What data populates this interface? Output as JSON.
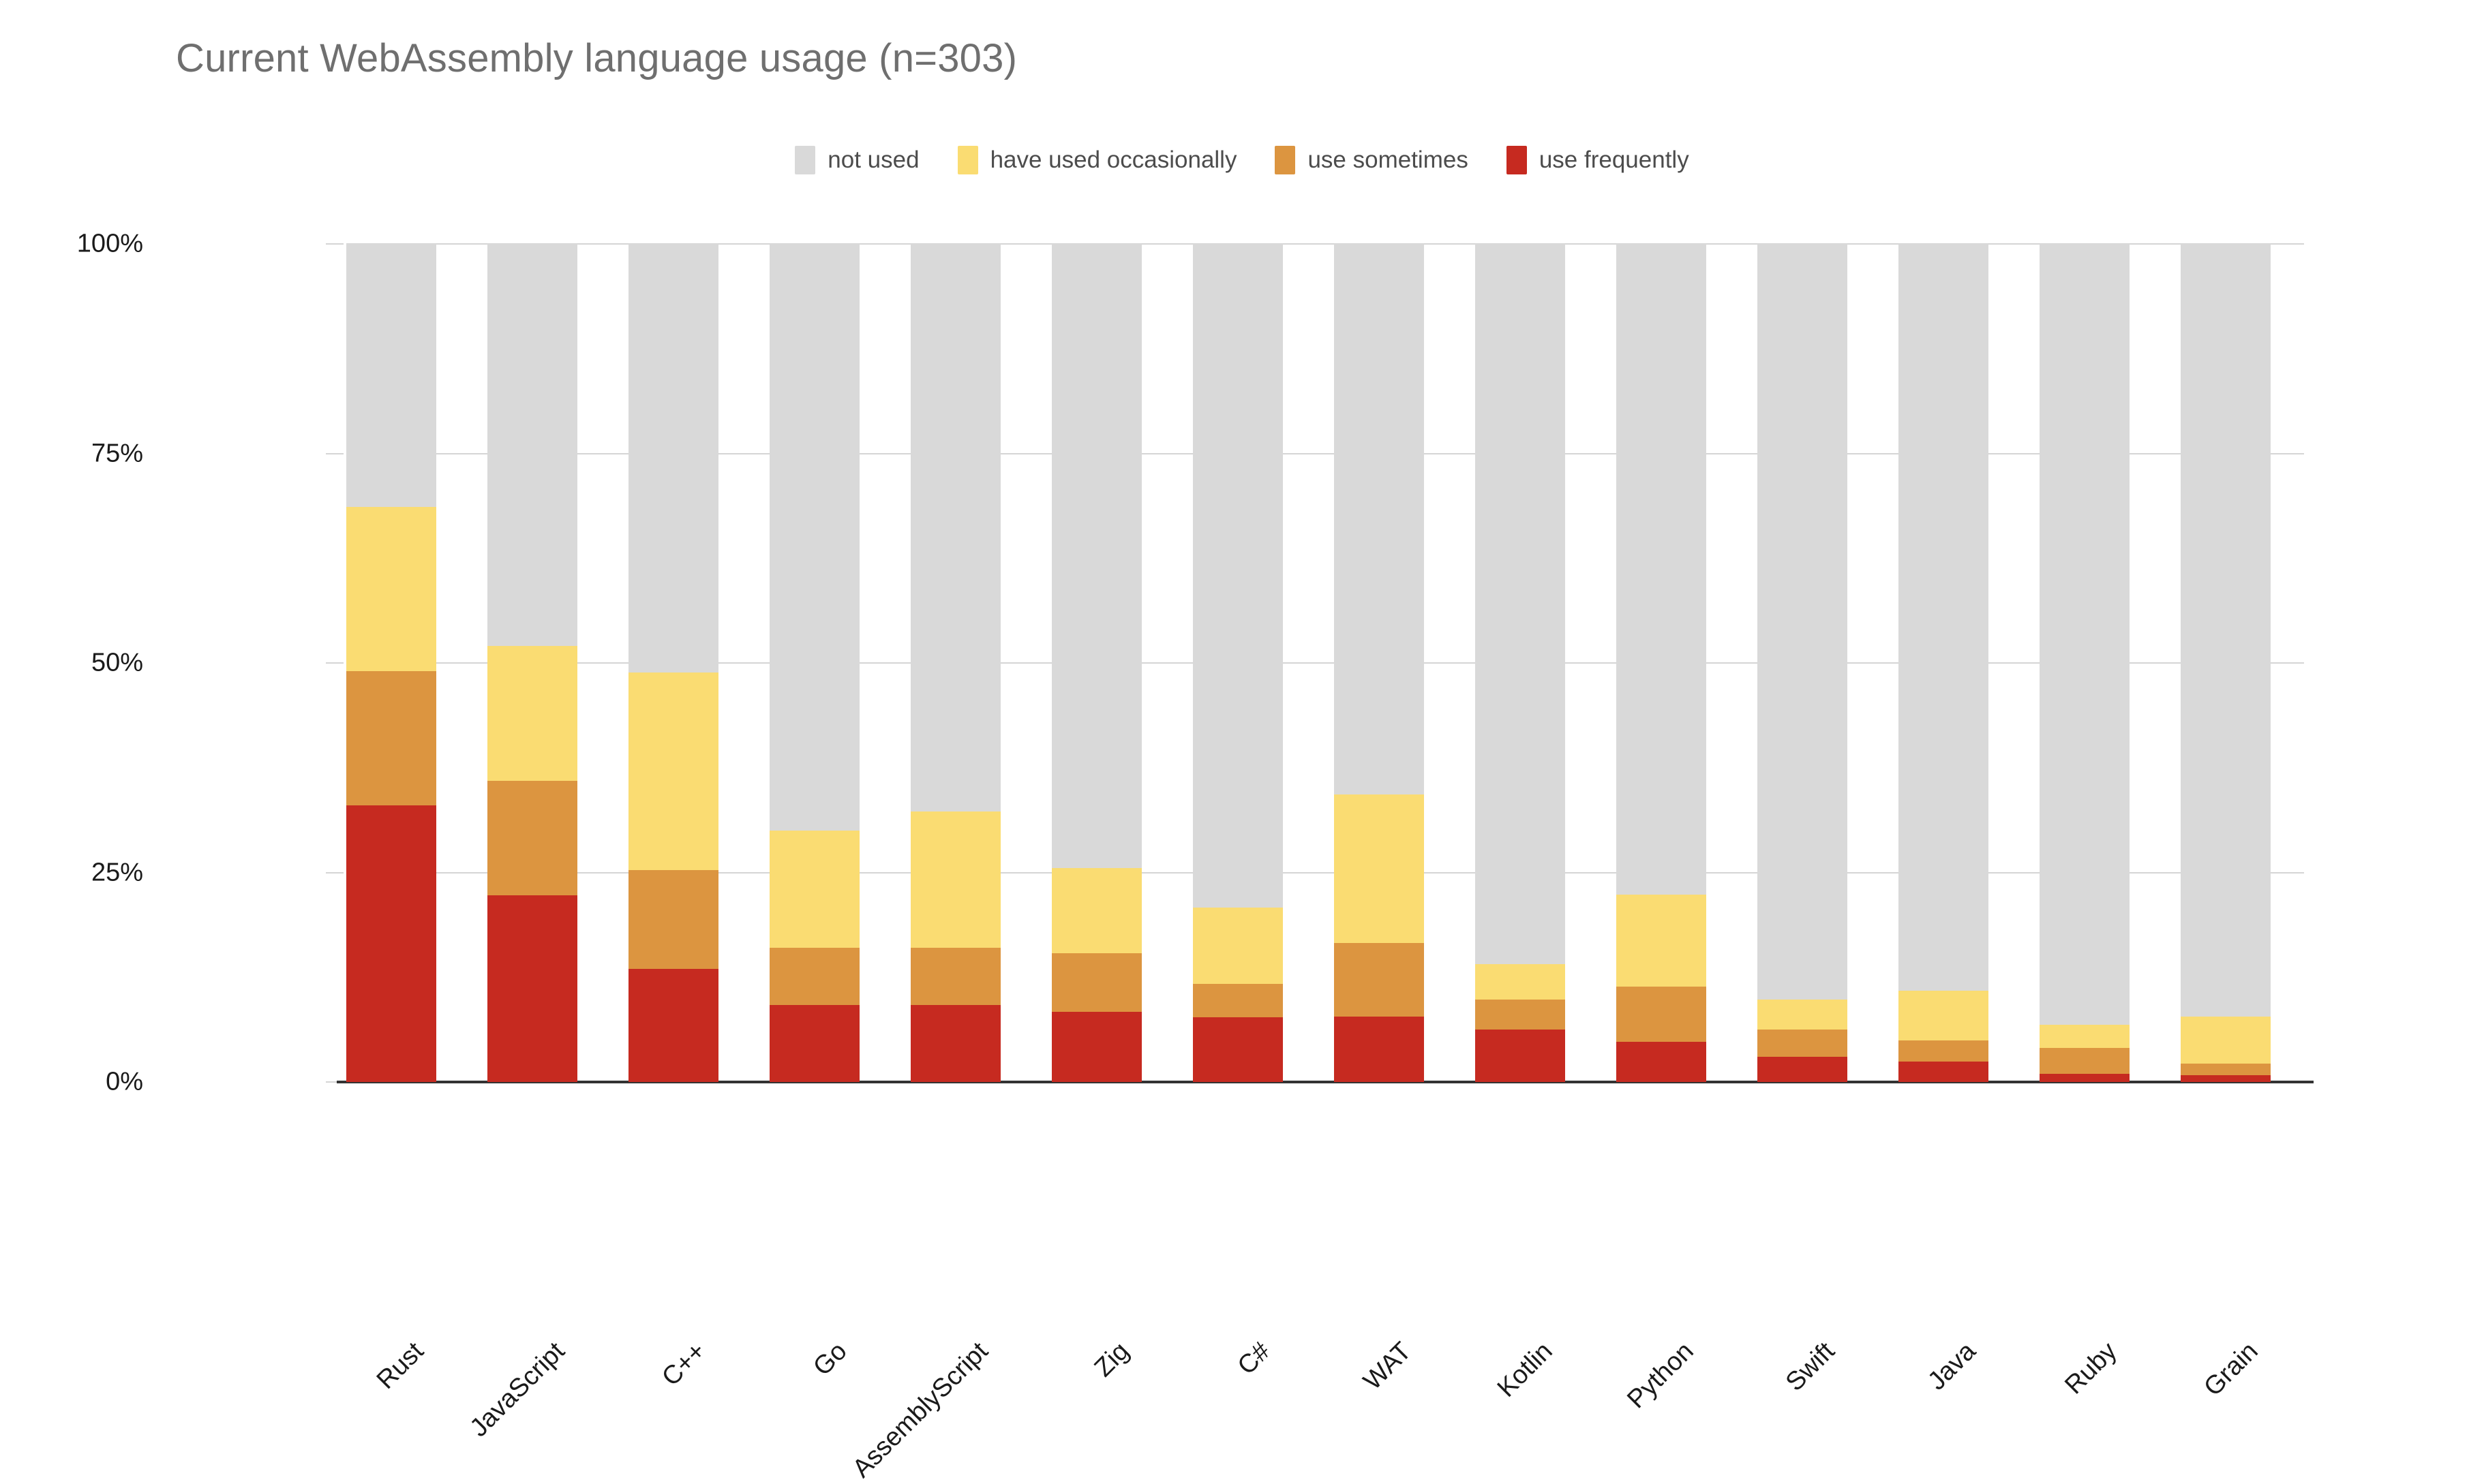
{
  "chart_title": "Current WebAssembly language usage (n=303)",
  "legend": {
    "position": "top-center",
    "items": [
      {
        "label": "not used",
        "color": "#d9d9d9"
      },
      {
        "label": "have used occasionally",
        "color": "#fadc72"
      },
      {
        "label": "use sometimes",
        "color": "#dc9540"
      },
      {
        "label": "use frequently",
        "color": "#c62a20"
      }
    ]
  },
  "colors": {
    "not_used": "#d9d9d9",
    "have_used_occasionally": "#fadc72",
    "use_sometimes": "#dc9540",
    "use_frequently": "#c62a20",
    "title_text": "#6f6f6f",
    "axis_text": "#1a1a1a",
    "gridline": "#d5d5d5",
    "axis_line": "#333333"
  },
  "axes": {
    "y_label": "",
    "y_ticks": [
      "0%",
      "25%",
      "50%",
      "75%",
      "100%"
    ],
    "y_tick_values": [
      0,
      25,
      50,
      75,
      100
    ],
    "y_min": 0,
    "y_max": 100,
    "x_label": "",
    "grid": true
  },
  "chart_data": {
    "type": "bar",
    "subtype": "stacked-100-percent",
    "title": "Current WebAssembly language usage (n=303)",
    "xlabel": "",
    "ylabel": "",
    "ylim": [
      0,
      100
    ],
    "grid": true,
    "legend_position": "top-center",
    "categories": [
      "Rust",
      "JavaScript",
      "C++",
      "Go",
      "AssemblyScript",
      "Zig",
      "C#",
      "WAT",
      "Kotlin",
      "Python",
      "Swift",
      "Java",
      "Ruby",
      "Grain"
    ],
    "series": [
      {
        "name": "use frequently",
        "color": "#c62a20",
        "values": [
          33.0,
          22.3,
          13.5,
          9.2,
          9.2,
          8.4,
          7.7,
          7.8,
          6.3,
          4.8,
          3.0,
          2.4,
          1.0,
          0.8
        ]
      },
      {
        "name": "use sometimes",
        "color": "#dc9540",
        "values": [
          16.0,
          13.6,
          11.8,
          6.8,
          6.8,
          7.0,
          4.0,
          8.8,
          3.5,
          6.6,
          3.3,
          2.6,
          3.1,
          1.4
        ]
      },
      {
        "name": "have used occasionally",
        "color": "#fadc72",
        "values": [
          19.6,
          16.1,
          23.6,
          14.0,
          16.3,
          10.1,
          9.1,
          17.7,
          4.3,
          11.0,
          3.5,
          5.9,
          2.7,
          5.6
        ]
      },
      {
        "name": "not used",
        "color": "#d9d9d9",
        "values": [
          31.4,
          48.0,
          51.1,
          70.0,
          67.7,
          74.5,
          79.2,
          65.7,
          85.9,
          77.6,
          90.2,
          89.1,
          93.2,
          92.2
        ]
      }
    ],
    "stack_tops": {
      "use_frequently": [
        33.0,
        22.3,
        13.5,
        9.2,
        9.2,
        8.4,
        7.7,
        7.8,
        6.3,
        4.8,
        3.0,
        2.4,
        1.0,
        0.8
      ],
      "use_sometimes": [
        49.0,
        35.9,
        25.3,
        16.0,
        16.0,
        15.4,
        11.7,
        16.6,
        9.8,
        11.4,
        6.3,
        5.0,
        4.1,
        2.2
      ],
      "have_used_occasionally": [
        68.6,
        52.0,
        48.9,
        30.0,
        32.3,
        25.5,
        20.8,
        34.3,
        14.1,
        22.4,
        9.8,
        10.9,
        6.8,
        7.8
      ],
      "not_used": [
        100,
        100,
        100,
        100,
        100,
        100,
        100,
        100,
        100,
        100,
        100,
        100,
        100,
        100
      ]
    }
  }
}
